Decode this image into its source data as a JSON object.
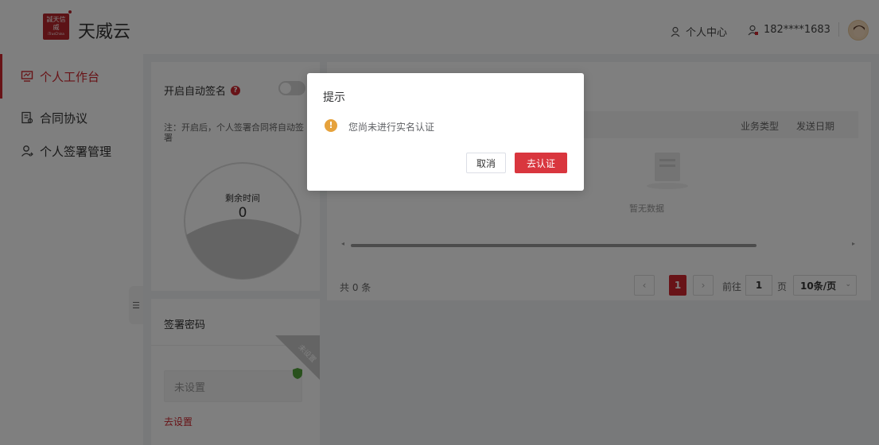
{
  "header": {
    "logo_text": "誠天信威",
    "logo_sub": "iTrusChina",
    "brand": "天威云",
    "personal_center": "个人中心",
    "phone": "182****1683"
  },
  "sidebar": {
    "items": [
      {
        "label": "个人工作台",
        "icon": "monitor-icon",
        "active": true
      },
      {
        "label": "合同协议",
        "icon": "document-icon",
        "active": false
      },
      {
        "label": "个人签署管理",
        "icon": "user-manage-icon",
        "active": false
      }
    ]
  },
  "auto_sign": {
    "title": "开启自动签名",
    "note": "注：开启后，个人签署合同将自动签署",
    "remaining_label": "剩余时间",
    "remaining_value": "0"
  },
  "sign_password": {
    "title": "签署密码",
    "ribbon": "未设置",
    "status": "未设置",
    "link": "去设置"
  },
  "table": {
    "columns": [
      "业务类型",
      "发送日期"
    ],
    "empty": "暂无数据"
  },
  "pagination": {
    "total": "共 0 条",
    "current": "1",
    "goto_prefix": "前往",
    "goto_value": "1",
    "goto_suffix": "页",
    "page_size": "10条/页"
  },
  "dialog": {
    "title": "提示",
    "message": "您尚未进行实名认证",
    "cancel": "取消",
    "confirm": "去认证"
  },
  "colors": {
    "accent": "#d0272e",
    "warning": "#e6a23c",
    "overlay": "rgba(0,0,0,0.5)"
  }
}
